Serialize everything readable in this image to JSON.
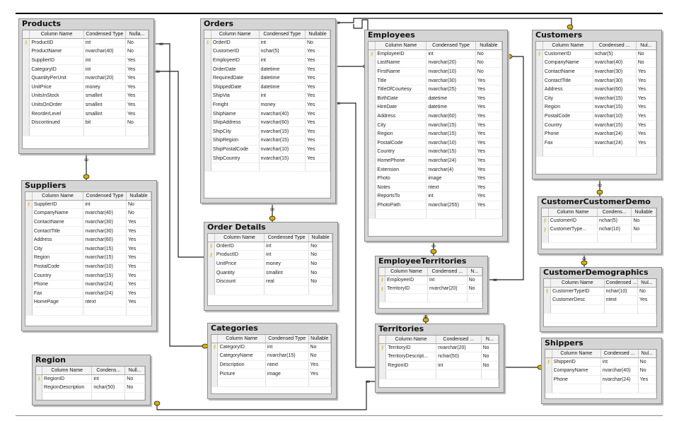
{
  "headers": [
    "Column Name",
    "Condensed Type",
    "Nullable"
  ],
  "headers_condensed": [
    "Column Name",
    "Condensed ...",
    "Nullable"
  ],
  "headers_null_trunc": [
    "Column Name",
    "Condensed Type",
    "Nulla..."
  ],
  "headers_both_trunc": [
    "Column Name",
    "Condensed ...",
    "Nul..."
  ],
  "headers_region": [
    "Column Name",
    "Condens...",
    "Null..."
  ],
  "headers_empterr": [
    "Column Name",
    "Condensed ...",
    "N..."
  ],
  "headers_ccd": [
    "Column Name",
    "Condens...",
    "Nullable"
  ],
  "tables": {
    "products": {
      "title": "Products",
      "rows": [
        {
          "key": true,
          "name": "ProductID",
          "type": "int",
          "null": "No"
        },
        {
          "name": "ProductName",
          "type": "nvarchar(40)",
          "null": "No"
        },
        {
          "name": "SupplierID",
          "type": "int",
          "null": "Yes"
        },
        {
          "name": "CategoryID",
          "type": "int",
          "null": "Yes"
        },
        {
          "name": "QuantityPerUnit",
          "type": "nvarchar(20)",
          "null": "Yes"
        },
        {
          "name": "UnitPrice",
          "type": "money",
          "null": "Yes"
        },
        {
          "name": "UnitsInStock",
          "type": "smallint",
          "null": "Yes"
        },
        {
          "name": "UnitsOnOrder",
          "type": "smallint",
          "null": "Yes"
        },
        {
          "name": "ReorderLevel",
          "type": "smallint",
          "null": "Yes"
        },
        {
          "name": "Discontinued",
          "type": "bit",
          "null": "No"
        }
      ]
    },
    "orders": {
      "title": "Orders",
      "rows": [
        {
          "key": true,
          "name": "OrderID",
          "type": "int",
          "null": "No"
        },
        {
          "name": "CustomerID",
          "type": "nchar(5)",
          "null": "Yes"
        },
        {
          "name": "EmployeeID",
          "type": "int",
          "null": "Yes"
        },
        {
          "name": "OrderDate",
          "type": "datetime",
          "null": "Yes"
        },
        {
          "name": "RequiredDate",
          "type": "datetime",
          "null": "Yes"
        },
        {
          "name": "ShippedDate",
          "type": "datetime",
          "null": "Yes"
        },
        {
          "name": "ShipVia",
          "type": "int",
          "null": "Yes"
        },
        {
          "name": "Freight",
          "type": "money",
          "null": "Yes"
        },
        {
          "name": "ShipName",
          "type": "nvarchar(40)",
          "null": "Yes"
        },
        {
          "name": "ShipAddress",
          "type": "nvarchar(60)",
          "null": "Yes"
        },
        {
          "name": "ShipCity",
          "type": "nvarchar(15)",
          "null": "Yes"
        },
        {
          "name": "ShipRegion",
          "type": "nvarchar(15)",
          "null": "Yes"
        },
        {
          "name": "ShipPostalCode",
          "type": "nvarchar(10)",
          "null": "Yes"
        },
        {
          "name": "ShipCountry",
          "type": "nvarchar(15)",
          "null": "Yes"
        }
      ]
    },
    "employees": {
      "title": "Employees",
      "rows": [
        {
          "key": true,
          "name": "EmployeeID",
          "type": "int",
          "null": "No"
        },
        {
          "name": "LastName",
          "type": "nvarchar(20)",
          "null": "No"
        },
        {
          "name": "FirstName",
          "type": "nvarchar(10)",
          "null": "No"
        },
        {
          "name": "Title",
          "type": "nvarchar(30)",
          "null": "Yes"
        },
        {
          "name": "TitleOfCourtesy",
          "type": "nvarchar(25)",
          "null": "Yes"
        },
        {
          "name": "BirthDate",
          "type": "datetime",
          "null": "Yes"
        },
        {
          "name": "HireDate",
          "type": "datetime",
          "null": "Yes"
        },
        {
          "name": "Address",
          "type": "nvarchar(60)",
          "null": "Yes"
        },
        {
          "name": "City",
          "type": "nvarchar(15)",
          "null": "Yes"
        },
        {
          "name": "Region",
          "type": "nvarchar(15)",
          "null": "Yes"
        },
        {
          "name": "PostalCode",
          "type": "nvarchar(10)",
          "null": "Yes"
        },
        {
          "name": "Country",
          "type": "nvarchar(15)",
          "null": "Yes"
        },
        {
          "name": "HomePhone",
          "type": "nvarchar(24)",
          "null": "Yes"
        },
        {
          "name": "Extension",
          "type": "nvarchar(4)",
          "null": "Yes"
        },
        {
          "name": "Photo",
          "type": "image",
          "null": "Yes"
        },
        {
          "name": "Notes",
          "type": "ntext",
          "null": "Yes"
        },
        {
          "name": "ReportsTo",
          "type": "int",
          "null": "Yes"
        },
        {
          "name": "PhotoPath",
          "type": "nvarchar(255)",
          "null": "Yes"
        }
      ]
    },
    "customers": {
      "title": "Customers",
      "rows": [
        {
          "key": true,
          "name": "CustomerID",
          "type": "nchar(5)",
          "null": "No"
        },
        {
          "name": "CompanyName",
          "type": "nvarchar(40)",
          "null": "No"
        },
        {
          "name": "ContactName",
          "type": "nvarchar(30)",
          "null": "Yes"
        },
        {
          "name": "ContactTitle",
          "type": "nvarchar(30)",
          "null": "Yes"
        },
        {
          "name": "Address",
          "type": "nvarchar(60)",
          "null": "Yes"
        },
        {
          "name": "City",
          "type": "nvarchar(15)",
          "null": "Yes"
        },
        {
          "name": "Region",
          "type": "nvarchar(15)",
          "null": "Yes"
        },
        {
          "name": "PostalCode",
          "type": "nvarchar(10)",
          "null": "Yes"
        },
        {
          "name": "Country",
          "type": "nvarchar(15)",
          "null": "Yes"
        },
        {
          "name": "Phone",
          "type": "nvarchar(24)",
          "null": "Yes"
        },
        {
          "name": "Fax",
          "type": "nvarchar(24)",
          "null": "Yes"
        }
      ]
    },
    "suppliers": {
      "title": "Suppliers",
      "rows": [
        {
          "key": true,
          "name": "SupplierID",
          "type": "int",
          "null": "No"
        },
        {
          "name": "CompanyName",
          "type": "nvarchar(40)",
          "null": "No"
        },
        {
          "name": "ContactName",
          "type": "nvarchar(30)",
          "null": "Yes"
        },
        {
          "name": "ContactTitle",
          "type": "nvarchar(30)",
          "null": "Yes"
        },
        {
          "name": "Address",
          "type": "nvarchar(60)",
          "null": "Yes"
        },
        {
          "name": "City",
          "type": "nvarchar(15)",
          "null": "Yes"
        },
        {
          "name": "Region",
          "type": "nvarchar(15)",
          "null": "Yes"
        },
        {
          "name": "PostalCode",
          "type": "nvarchar(10)",
          "null": "Yes"
        },
        {
          "name": "Country",
          "type": "nvarchar(15)",
          "null": "Yes"
        },
        {
          "name": "Phone",
          "type": "nvarchar(24)",
          "null": "Yes"
        },
        {
          "name": "Fax",
          "type": "nvarchar(24)",
          "null": "Yes"
        },
        {
          "name": "HomePage",
          "type": "ntext",
          "null": "Yes"
        }
      ]
    },
    "orderdetails": {
      "title": "Order Details",
      "rows": [
        {
          "key": true,
          "name": "OrderID",
          "type": "int",
          "null": "No"
        },
        {
          "key": true,
          "name": "ProductID",
          "type": "int",
          "null": "No"
        },
        {
          "name": "UnitPrice",
          "type": "money",
          "null": "No"
        },
        {
          "name": "Quantity",
          "type": "smallint",
          "null": "No"
        },
        {
          "name": "Discount",
          "type": "real",
          "null": "No"
        }
      ]
    },
    "categories": {
      "title": "Categories",
      "rows": [
        {
          "key": true,
          "name": "CategoryID",
          "type": "int",
          "null": "No"
        },
        {
          "name": "CategoryName",
          "type": "nvarchar(15)",
          "null": "No"
        },
        {
          "name": "Description",
          "type": "ntext",
          "null": "Yes"
        },
        {
          "name": "Picture",
          "type": "image",
          "null": "Yes"
        }
      ]
    },
    "region": {
      "title": "Region",
      "rows": [
        {
          "key": true,
          "name": "RegionID",
          "type": "int",
          "null": "No"
        },
        {
          "name": "RegionDescription",
          "type": "nchar(50)",
          "null": "No"
        }
      ]
    },
    "employeeterritories": {
      "title": "EmployeeTerritories",
      "rows": [
        {
          "key": true,
          "name": "EmployeeID",
          "type": "int",
          "null": "No"
        },
        {
          "key": true,
          "name": "TerritoryID",
          "type": "nvarchar(20)",
          "null": "No"
        }
      ]
    },
    "territories": {
      "title": "Territories",
      "rows": [
        {
          "key": true,
          "name": "TerritoryID",
          "type": "nvarchar(20)",
          "null": "No"
        },
        {
          "name": "TerritoryDescript...",
          "type": "nchar(50)",
          "null": "No"
        },
        {
          "name": "RegionID",
          "type": "int",
          "null": "No"
        }
      ]
    },
    "customercustomerdemo": {
      "title": "CustomerCustomerDemo",
      "rows": [
        {
          "key": true,
          "name": "CustomerID",
          "type": "nchar(5)",
          "null": "No"
        },
        {
          "key": true,
          "name": "CustomerType...",
          "type": "nchar(10)",
          "null": "No"
        }
      ]
    },
    "customerdemographics": {
      "title": "CustomerDemographics",
      "rows": [
        {
          "key": true,
          "name": "CustomerTypeID",
          "type": "nchar(10)",
          "null": "No"
        },
        {
          "name": "CustomerDesc",
          "type": "ntext",
          "null": "Yes"
        }
      ]
    },
    "shippers": {
      "title": "Shippers",
      "rows": [
        {
          "key": true,
          "name": "ShipperID",
          "type": "int",
          "null": "No"
        },
        {
          "name": "CompanyName",
          "type": "nvarchar(40)",
          "null": "No"
        },
        {
          "name": "Phone",
          "type": "nvarchar(24)",
          "null": "Yes"
        }
      ]
    }
  },
  "colors": {
    "key_icon": "#d8b100",
    "title_bar": "#d5d5d5",
    "line": "#222222"
  }
}
